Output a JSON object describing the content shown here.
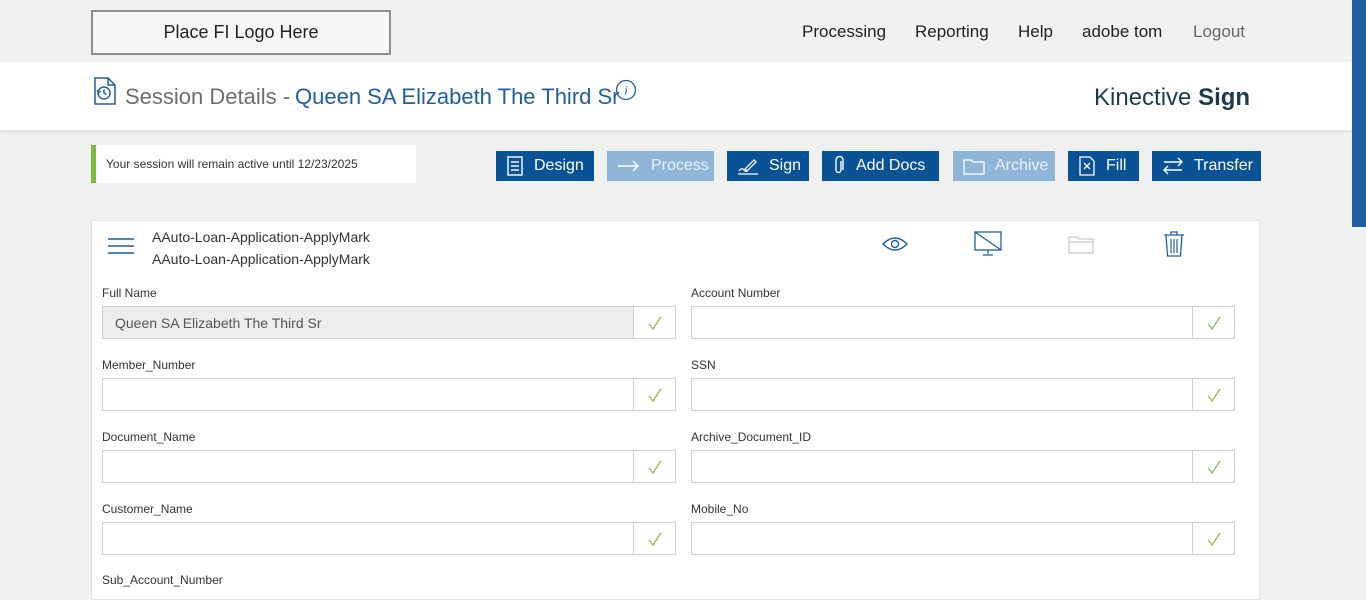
{
  "topbar": {
    "logo_text": "Place FI Logo Here",
    "nav": [
      "Processing",
      "Reporting",
      "Help",
      "adobe tom",
      "Logout"
    ]
  },
  "header": {
    "title_prefix": "Session Details -",
    "title_name": "Queen SA Elizabeth The Third Sr",
    "brand_light": "Kinective",
    "brand_bold": "Sign"
  },
  "session_notice": "Your session will remain active until 12/23/2025",
  "actions": {
    "design": "Design",
    "process": "Process",
    "sign": "Sign",
    "add_docs": "Add Docs",
    "archive": "Archive",
    "fill": "Fill",
    "transfer": "Transfer"
  },
  "document": {
    "title_line1": "AAuto-Loan-Application-ApplyMark",
    "title_line2": "AAuto-Loan-Application-ApplyMark"
  },
  "fields": {
    "full_name": {
      "label": "Full Name",
      "value": "Queen SA Elizabeth The Third Sr"
    },
    "account_number": {
      "label": "Account Number",
      "value": ""
    },
    "member_number": {
      "label": "Member_Number",
      "value": ""
    },
    "ssn": {
      "label": "SSN",
      "value": ""
    },
    "document_name": {
      "label": "Document_Name",
      "value": ""
    },
    "archive_document_id": {
      "label": "Archive_Document_ID",
      "value": ""
    },
    "customer_name": {
      "label": "Customer_Name",
      "value": ""
    },
    "mobile_no": {
      "label": "Mobile_No",
      "value": ""
    },
    "sub_account_number": {
      "label": "Sub_Account_Number"
    }
  },
  "colors": {
    "primary": "#0a5296",
    "primary_disabled": "#8fb6d8",
    "title_blue": "#1f5fa0",
    "notice_accent": "#7dbb3c",
    "check_green": "#8bbf5a"
  },
  "icons": {
    "header": [
      "history-doc-icon",
      "info-icon"
    ],
    "card": [
      "menu-icon",
      "eye-icon",
      "monitor-off-icon",
      "folder-icon",
      "trash-icon"
    ],
    "fields": "check-icon"
  }
}
